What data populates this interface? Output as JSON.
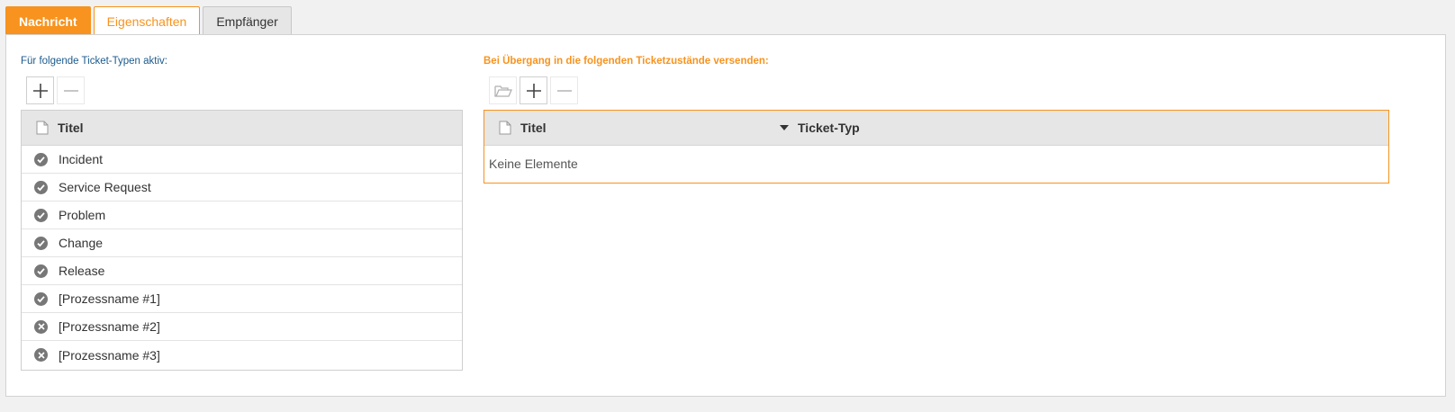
{
  "tabs": [
    {
      "label": "Nachricht"
    },
    {
      "label": "Eigenschaften"
    },
    {
      "label": "Empfänger"
    }
  ],
  "left": {
    "label": "Für folgende Ticket-Typen aktiv:",
    "toolbar": [
      {
        "icon": "plus-icon",
        "enabled": true
      },
      {
        "icon": "minus-icon",
        "enabled": false
      }
    ],
    "header": {
      "title": "Titel",
      "icon": "document-icon"
    },
    "rows": [
      {
        "title": "Incident",
        "status": "active",
        "icon": "check-circle-icon"
      },
      {
        "title": "Service Request",
        "status": "active",
        "icon": "check-circle-icon"
      },
      {
        "title": "Problem",
        "status": "active",
        "icon": "check-circle-icon"
      },
      {
        "title": "Change",
        "status": "active",
        "icon": "check-circle-icon"
      },
      {
        "title": "Release",
        "status": "active",
        "icon": "check-circle-icon"
      },
      {
        "title": "[Prozessname #1]",
        "status": "active",
        "icon": "check-circle-icon"
      },
      {
        "title": "[Prozessname #2]",
        "status": "inactive",
        "icon": "x-circle-icon"
      },
      {
        "title": "[Prozessname #3]",
        "status": "inactive",
        "icon": "x-circle-icon"
      }
    ]
  },
  "right": {
    "label": "Bei Übergang in die folgenden Ticketzustände versenden:",
    "toolbar": [
      {
        "icon": "folder-open-icon",
        "enabled": false
      },
      {
        "icon": "plus-icon",
        "enabled": true
      },
      {
        "icon": "minus-icon",
        "enabled": false
      }
    ],
    "header": {
      "title": "Titel",
      "col2": "Ticket-Typ",
      "icon": "document-icon",
      "sort_icon": "sort-desc-icon"
    },
    "empty_text": "Keine Elemente"
  },
  "colors": {
    "accent": "#f7931e",
    "label_blue": "#1c5a8c",
    "status_gray": "#777777"
  }
}
